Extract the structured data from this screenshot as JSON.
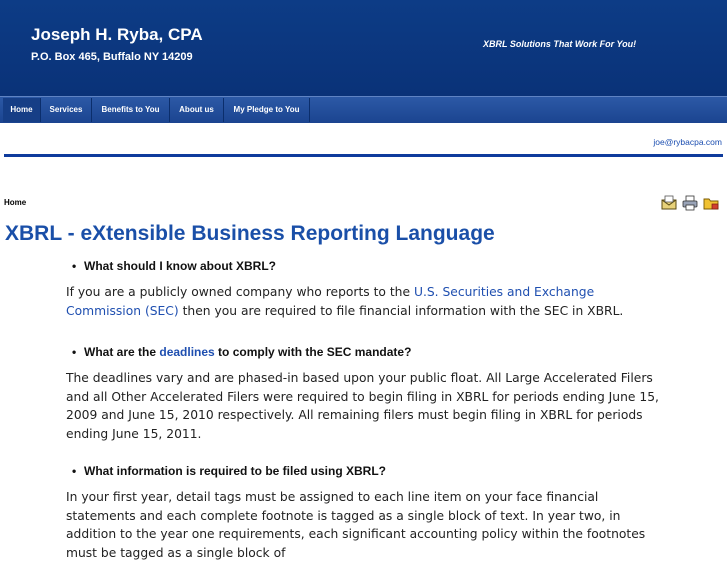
{
  "header": {
    "name": "Joseph H. Ryba, CPA",
    "address": "P.O. Box 465, Buffalo NY 14209",
    "tagline": "XBRL Solutions That Work For You!"
  },
  "nav": {
    "items": [
      {
        "label": "Home"
      },
      {
        "label": "Services"
      },
      {
        "label": "Benefits to You"
      },
      {
        "label": "About us"
      },
      {
        "label": "My Pledge to You"
      }
    ]
  },
  "contact": {
    "email": "joe@rybacpa.com"
  },
  "breadcrumb": "Home",
  "tools": [
    "email-page-icon",
    "print-icon",
    "folder-icon"
  ],
  "main": {
    "title": "XBRL - eXtensible Business Reporting Language",
    "sections": [
      {
        "question": "What should I know about XBRL?",
        "p_before": "If you are a publicly owned company who reports to the ",
        "p_link": "U.S. Securities and Exchange Commission (SEC)",
        "p_after": " then you are required to file financial information with the SEC in XBRL."
      },
      {
        "question_before": "What are the ",
        "question_link": "deadlines",
        "question_after": " to comply with the SEC mandate?",
        "p": "The deadlines vary and are phased-in based upon your public float.  All Large Accelerated Filers and all Other Accelerated Filers were required to begin filing in XBRL for periods ending June 15, 2009 and June 15, 2010 respectively.  All remaining filers must begin filing in XBRL for periods ending June 15, 2011."
      },
      {
        "question": "What information is required to be filed using XBRL?",
        "p": "In your first year, detail tags must be assigned to each line item on your face financial statements and each complete footnote is tagged as a single block of text.  In year two, in addition to the year one requirements, each significant accounting policy within the footnotes must be tagged as a single block of"
      }
    ]
  },
  "colors": {
    "header_bg": "#0d3c86",
    "nav_bg": "#1b4490",
    "title": "#1a4fa8",
    "link": "#1f4fb0"
  }
}
